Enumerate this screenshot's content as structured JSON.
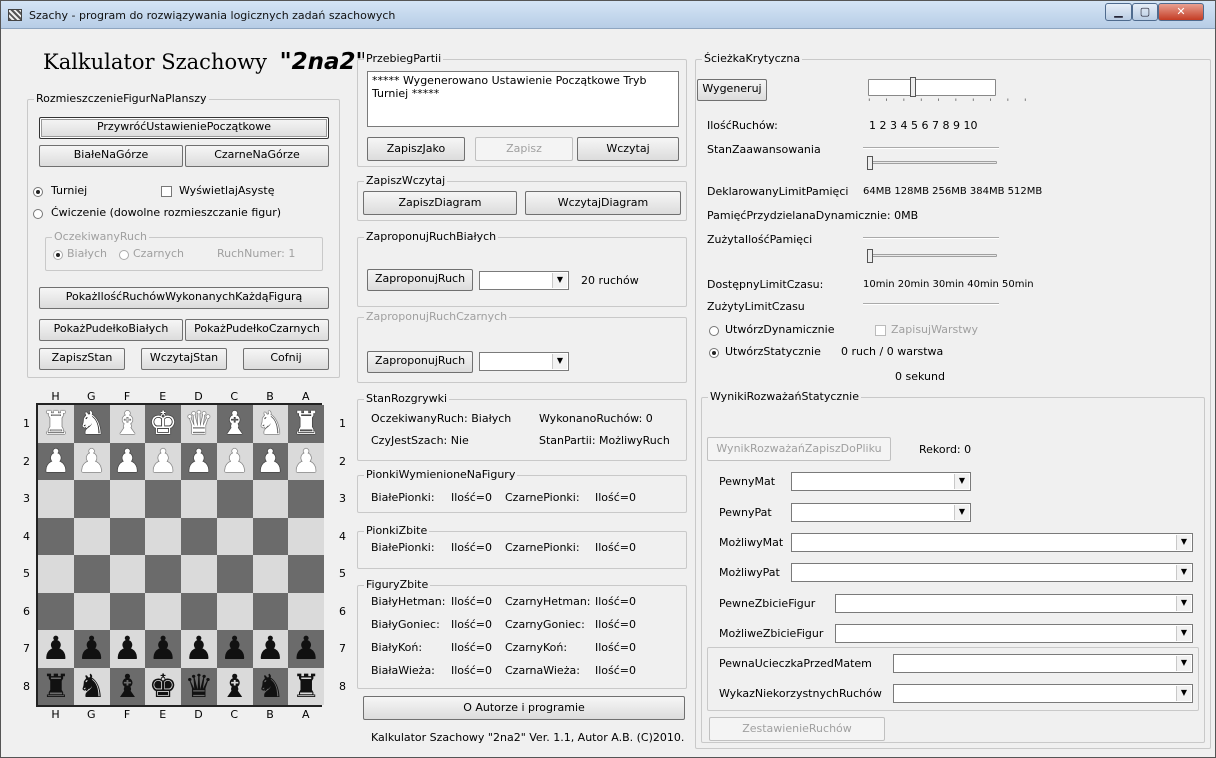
{
  "window": {
    "title": "Szachy - program do rozwiązywania logicznych zadań szachowych"
  },
  "header": {
    "title_prefix": "Kalkulator Szachowy",
    "title_name": "\"2na2\""
  },
  "placement": {
    "group": "RozmieszczenieFigurNaPlanszy",
    "restore_btn": "PrzywróćUstawieniePoczątkowe",
    "white_top_btn": "BiałeNaGórze",
    "black_top_btn": "CzarneNaGórze",
    "tournament": "Turniej",
    "show_assist": "WyświetlajAsystę",
    "exercise": "Ćwiczenie (dowolne rozmieszczanie figur)",
    "expected_group": "OczekiwanyRuch",
    "white_radio": "Białych",
    "black_radio": "Czarnych",
    "move_number": "RuchNumer: 1",
    "show_moves_btn": "PokażIlośćRuchówWykonanychKażdąFigurą",
    "white_box_btn": "PokażPudełkoBiałych",
    "black_box_btn": "PokażPudełkoCzarnych",
    "save_state_btn": "ZapiszStan",
    "load_state_btn": "WczytajStan",
    "undo_btn": "Cofnij"
  },
  "board": {
    "files_top": [
      "H",
      "G",
      "F",
      "E",
      "D",
      "C",
      "B",
      "A"
    ],
    "ranks": [
      "1",
      "2",
      "3",
      "4",
      "5",
      "6",
      "7",
      "8"
    ],
    "rows": [
      [
        "♜",
        "♞",
        "♝",
        "♚",
        "♛",
        "♝",
        "♞",
        "♜"
      ],
      [
        "♟",
        "♟",
        "♟",
        "♟",
        "♟",
        "♟",
        "♟",
        "♟"
      ],
      [
        "",
        "",
        "",
        "",
        "",
        "",
        "",
        ""
      ],
      [
        "",
        "",
        "",
        "",
        "",
        "",
        "",
        ""
      ],
      [
        "",
        "",
        "",
        "",
        "",
        "",
        "",
        ""
      ],
      [
        "",
        "",
        "",
        "",
        "",
        "",
        "",
        ""
      ],
      [
        "♟",
        "♟",
        "♟",
        "♟",
        "♟",
        "♟",
        "♟",
        "♟"
      ],
      [
        "♜",
        "♞",
        "♝",
        "♚",
        "♛",
        "♝",
        "♞",
        "♜"
      ]
    ],
    "row_colors": [
      "w",
      "w",
      "",
      "",
      "",
      "",
      "b",
      "b"
    ]
  },
  "game": {
    "group": "PrzebiegPartii",
    "log": "***** Wygenerowano Ustawienie Początkowe Tryb Turniej *****",
    "save_as_btn": "ZapiszJako",
    "save_btn": "Zapisz",
    "load_btn": "Wczytaj"
  },
  "diagram": {
    "group": "ZapiszWczytaj",
    "save_btn": "ZapiszDiagram",
    "load_btn": "WczytajDiagram"
  },
  "propose_white": {
    "group": "ZaproponujRuchBiałych",
    "btn": "ZaproponujRuch",
    "count": "20 ruchów"
  },
  "propose_black": {
    "group": "ZaproponujRuchCzarnych",
    "btn": "ZaproponujRuch"
  },
  "status": {
    "group": "StanRozgrywki",
    "expected": "OczekiwanyRuch: Białych",
    "done": "WykonanoRuchów: 0",
    "check": "CzyJestSzach: Nie",
    "state": "StanPartii: MożliwyRuch"
  },
  "promoted": {
    "group": "PionkiWymienioneNaFigury",
    "white": "BiałePionki:",
    "white_n": "Ilość=0",
    "black": "CzarnePionki:",
    "black_n": "Ilość=0"
  },
  "captured_pawns": {
    "group": "PionkiZbite",
    "white": "BiałePionki:",
    "white_n": "Ilość=0",
    "black": "CzarnePionki:",
    "black_n": "Ilość=0"
  },
  "captured_pieces": {
    "group": "FiguryZbite",
    "rows": [
      {
        "w": "BiałyHetman:",
        "wn": "Ilość=0",
        "b": "CzarnyHetman:",
        "bn": "Ilość=0"
      },
      {
        "w": "BiałyGoniec:",
        "wn": "Ilość=0",
        "b": "CzarnyGoniec:",
        "bn": "Ilość=0"
      },
      {
        "w": "BiałyKoń:",
        "wn": "Ilość=0",
        "b": "CzarnyKoń:",
        "bn": "Ilość=0"
      },
      {
        "w": "BiałaWieża:",
        "wn": "Ilość=0",
        "b": "CzarnaWieża:",
        "bn": "Ilość=0"
      }
    ]
  },
  "about": {
    "btn": "O Autorze i programie",
    "version": "Kalkulator Szachowy \"2na2\" Ver. 1.1, Autor A.B. (C)2010."
  },
  "critical": {
    "group": "ŚcieżkaKrytyczna",
    "generate_btn": "Wygeneruj",
    "moves_label": "IlośćRuchów:",
    "moves_scale": "1 2 3 4 5 6 7 8 9 10",
    "progress_label": "StanZaawansowania",
    "mem_label": "DeklarowanyLimitPamięci",
    "mem_scale": "64MB 128MB 256MB 384MB 512MB",
    "dyn_mem": "PamięćPrzydzielanaDynamicznie: 0MB",
    "used_mem": "ZużytaIlośćPamięci",
    "time_label": "DostępnyLimitCzasu:",
    "time_scale": "10min 20min 30min 40min 50min",
    "used_time": "ZużytyLimitCzasu",
    "dynamic": "UtwórzDynamicznie",
    "save_layers": "ZapisujWarstwy",
    "static": "UtwórzStatycznie",
    "layer_info": "0 ruch / 0 warstwa",
    "seconds": "0 sekund"
  },
  "results": {
    "group": "WynikiRozważańStatycznie",
    "save_btn": "WynikRozważańZapiszDoPliku",
    "record": "Rekord: 0",
    "sure_mate": "PewnyMat",
    "sure_stalemate": "PewnyPat",
    "possible_mate": "MożliwyMat",
    "possible_stalemate": "MożliwyPat",
    "sure_capture": "PewneZbicieFigur",
    "possible_capture": "MożliweZbicieFigur",
    "escape": "PewnaUcieczkaPrzedMatem",
    "bad_moves": "WykazNiekorzystnychRuchów",
    "summary_btn": "ZestawienieRuchów"
  }
}
